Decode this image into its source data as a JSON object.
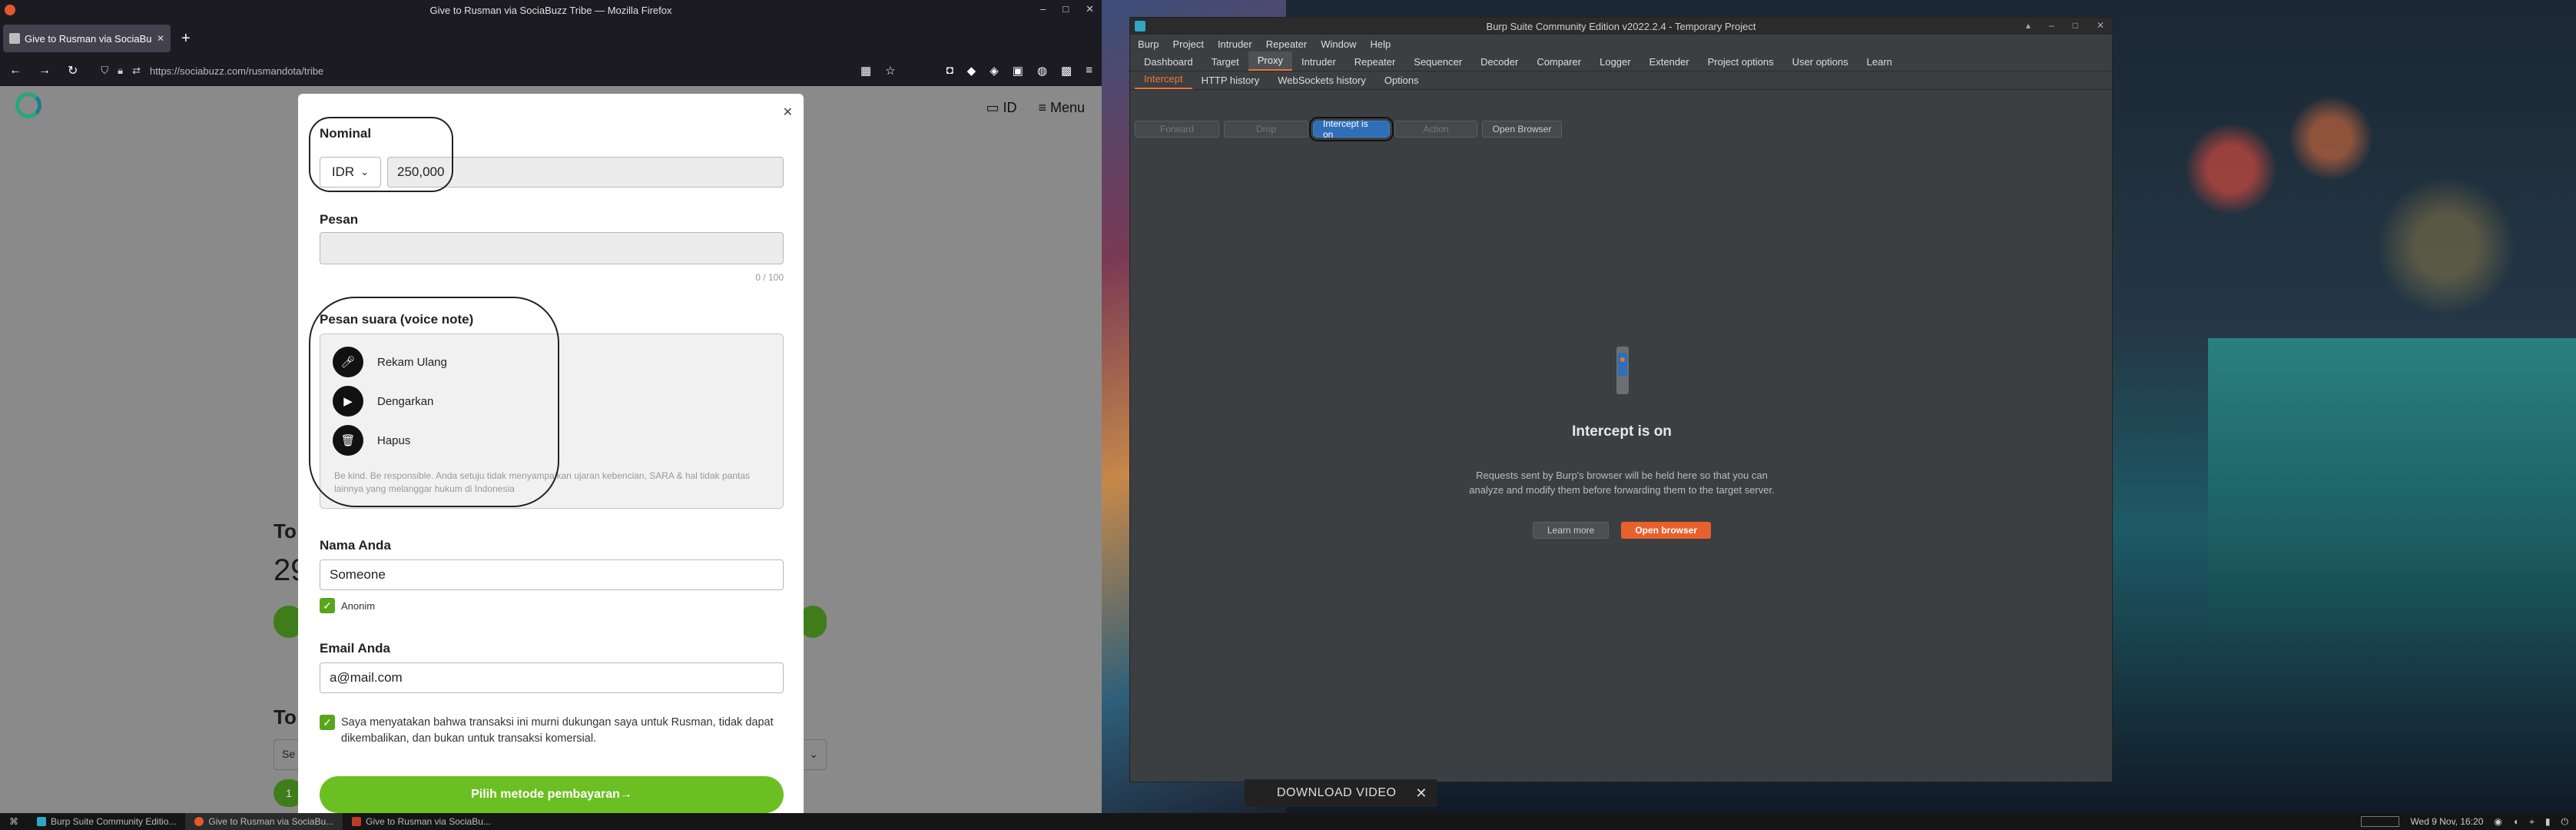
{
  "firefox": {
    "window_title": "Give to Rusman via SociaBuzz Tribe — Mozilla Firefox",
    "tab_title": "Give to Rusman via SociaBuzz",
    "url": "https://sociabuzz.com/rusmandota/tribe"
  },
  "site": {
    "lang_label": "ID",
    "menu_label": "Menu",
    "bg_heading1": "To",
    "bg_number": "29",
    "bg_heading2": "To",
    "bg_select": "Se",
    "bg_badge": "1"
  },
  "modal": {
    "nominal_label": "Nominal",
    "currency": "IDR",
    "amount": "250,000",
    "pesan_label": "Pesan",
    "counter": "0 / 100",
    "voice_label": "Pesan suara (voice note)",
    "voice_actions": [
      {
        "label": "Rekam Ulang",
        "icon": "mic-icon"
      },
      {
        "label": "Dengarkan",
        "icon": "play-icon"
      },
      {
        "label": "Hapus",
        "icon": "trash-icon"
      }
    ],
    "voice_note": "Be kind. Be responsible. Anda setuju tidak menyampaikan ujaran kebencian, SARA & hal tidak pantas lainnya yang melanggar hukum di Indonesia",
    "name_label": "Nama Anda",
    "name_value": "Someone",
    "anon_label": "Anonim",
    "email_label": "Email Anda",
    "email_value": "a@mail.com",
    "agree_text": "Saya menyatakan bahwa transaksi ini murni dukungan saya untuk Rusman, tidak dapat dikembalikan, dan bukan untuk transaksi komersial.",
    "submit_label": "Pilih metode pembayaran→"
  },
  "burp": {
    "window_title": "Burp Suite Community Edition v2022.2.4 - Temporary Project",
    "menu": [
      "Burp",
      "Project",
      "Intruder",
      "Repeater",
      "Window",
      "Help"
    ],
    "tabs": [
      "Dashboard",
      "Target",
      "Proxy",
      "Intruder",
      "Repeater",
      "Sequencer",
      "Decoder",
      "Comparer",
      "Logger",
      "Extender",
      "Project options",
      "User options",
      "Learn"
    ],
    "active_tab": "Proxy",
    "subtabs": [
      "Intercept",
      "HTTP history",
      "WebSockets history",
      "Options"
    ],
    "active_subtab": "Intercept",
    "actions": {
      "forward": "Forward",
      "drop": "Drop",
      "intercept": "Intercept is on",
      "action": "Action",
      "open_browser": "Open Browser"
    },
    "panel": {
      "title": "Intercept is on",
      "desc_line1": "Requests sent by Burp's browser will be held here so that you can",
      "desc_line2": "analyze and modify them before forwarding them to the target server.",
      "learn_more": "Learn more",
      "open_browser": "Open browser"
    }
  },
  "toast": {
    "label": "DOWNLOAD VIDEO"
  },
  "taskbar": {
    "items": [
      "Burp Suite Community Editio...",
      "Give to Rusman via SociaBu...",
      "Give to Rusman via SociaBu..."
    ],
    "clock": "Wed  9 Nov, 16:20"
  },
  "colors": {
    "accent_green": "#6bbf22",
    "burp_orange": "#e8602c",
    "burp_blue": "#2e6fb8"
  }
}
